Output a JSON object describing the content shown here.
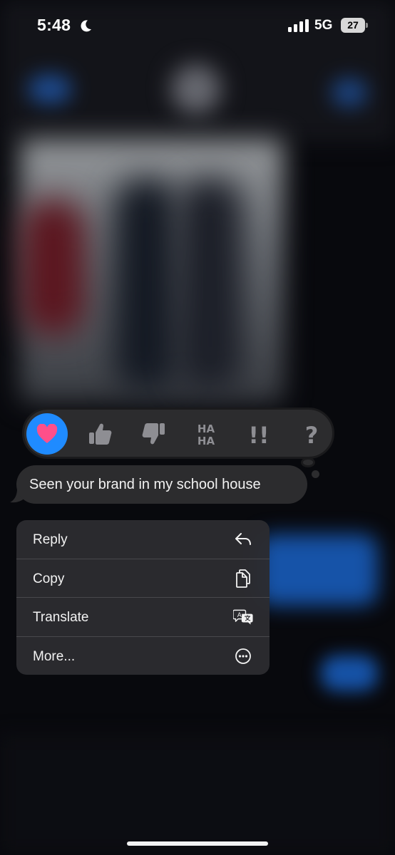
{
  "status_bar": {
    "time": "5:48",
    "network": "5G",
    "battery": "27"
  },
  "reactions": {
    "items": [
      {
        "name": "heart",
        "selected": true
      },
      {
        "name": "thumbs-up",
        "selected": false
      },
      {
        "name": "thumbs-down",
        "selected": false
      },
      {
        "name": "haha",
        "selected": false,
        "text_top": "HA",
        "text_bottom": "HA"
      },
      {
        "name": "exclamation",
        "selected": false,
        "text": "!!"
      },
      {
        "name": "question",
        "selected": false,
        "text": "?"
      }
    ],
    "accent_color": "#1f8bff",
    "heart_color": "#ff4f8a"
  },
  "message": {
    "text": "Seen your brand in my school house"
  },
  "menu": {
    "items": [
      {
        "label": "Reply",
        "icon": "reply-icon"
      },
      {
        "label": "Copy",
        "icon": "copy-icon"
      },
      {
        "label": "Translate",
        "icon": "translate-icon"
      },
      {
        "label": "More...",
        "icon": "more-icon"
      }
    ]
  }
}
